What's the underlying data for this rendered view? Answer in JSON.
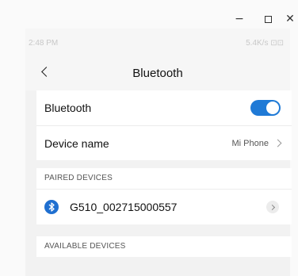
{
  "window": {
    "minimize_glyph": "−",
    "close_glyph": "✕"
  },
  "status_bar": {
    "time": "2:48 PM",
    "indicators": "5.4K/s ⊡⊡"
  },
  "nav": {
    "title": "Bluetooth"
  },
  "settings": {
    "bluetooth_label": "Bluetooth",
    "bluetooth_enabled": true,
    "device_name_label": "Device name",
    "device_name_value": "Mi Phone"
  },
  "paired": {
    "header": "PAIRED DEVICES",
    "devices": [
      {
        "name": "G510_002715000557"
      }
    ]
  },
  "available": {
    "header": "AVAILABLE DEVICES"
  },
  "colors": {
    "accent": "#1f7ad6",
    "bluetooth_icon": "#1f6fd0"
  }
}
